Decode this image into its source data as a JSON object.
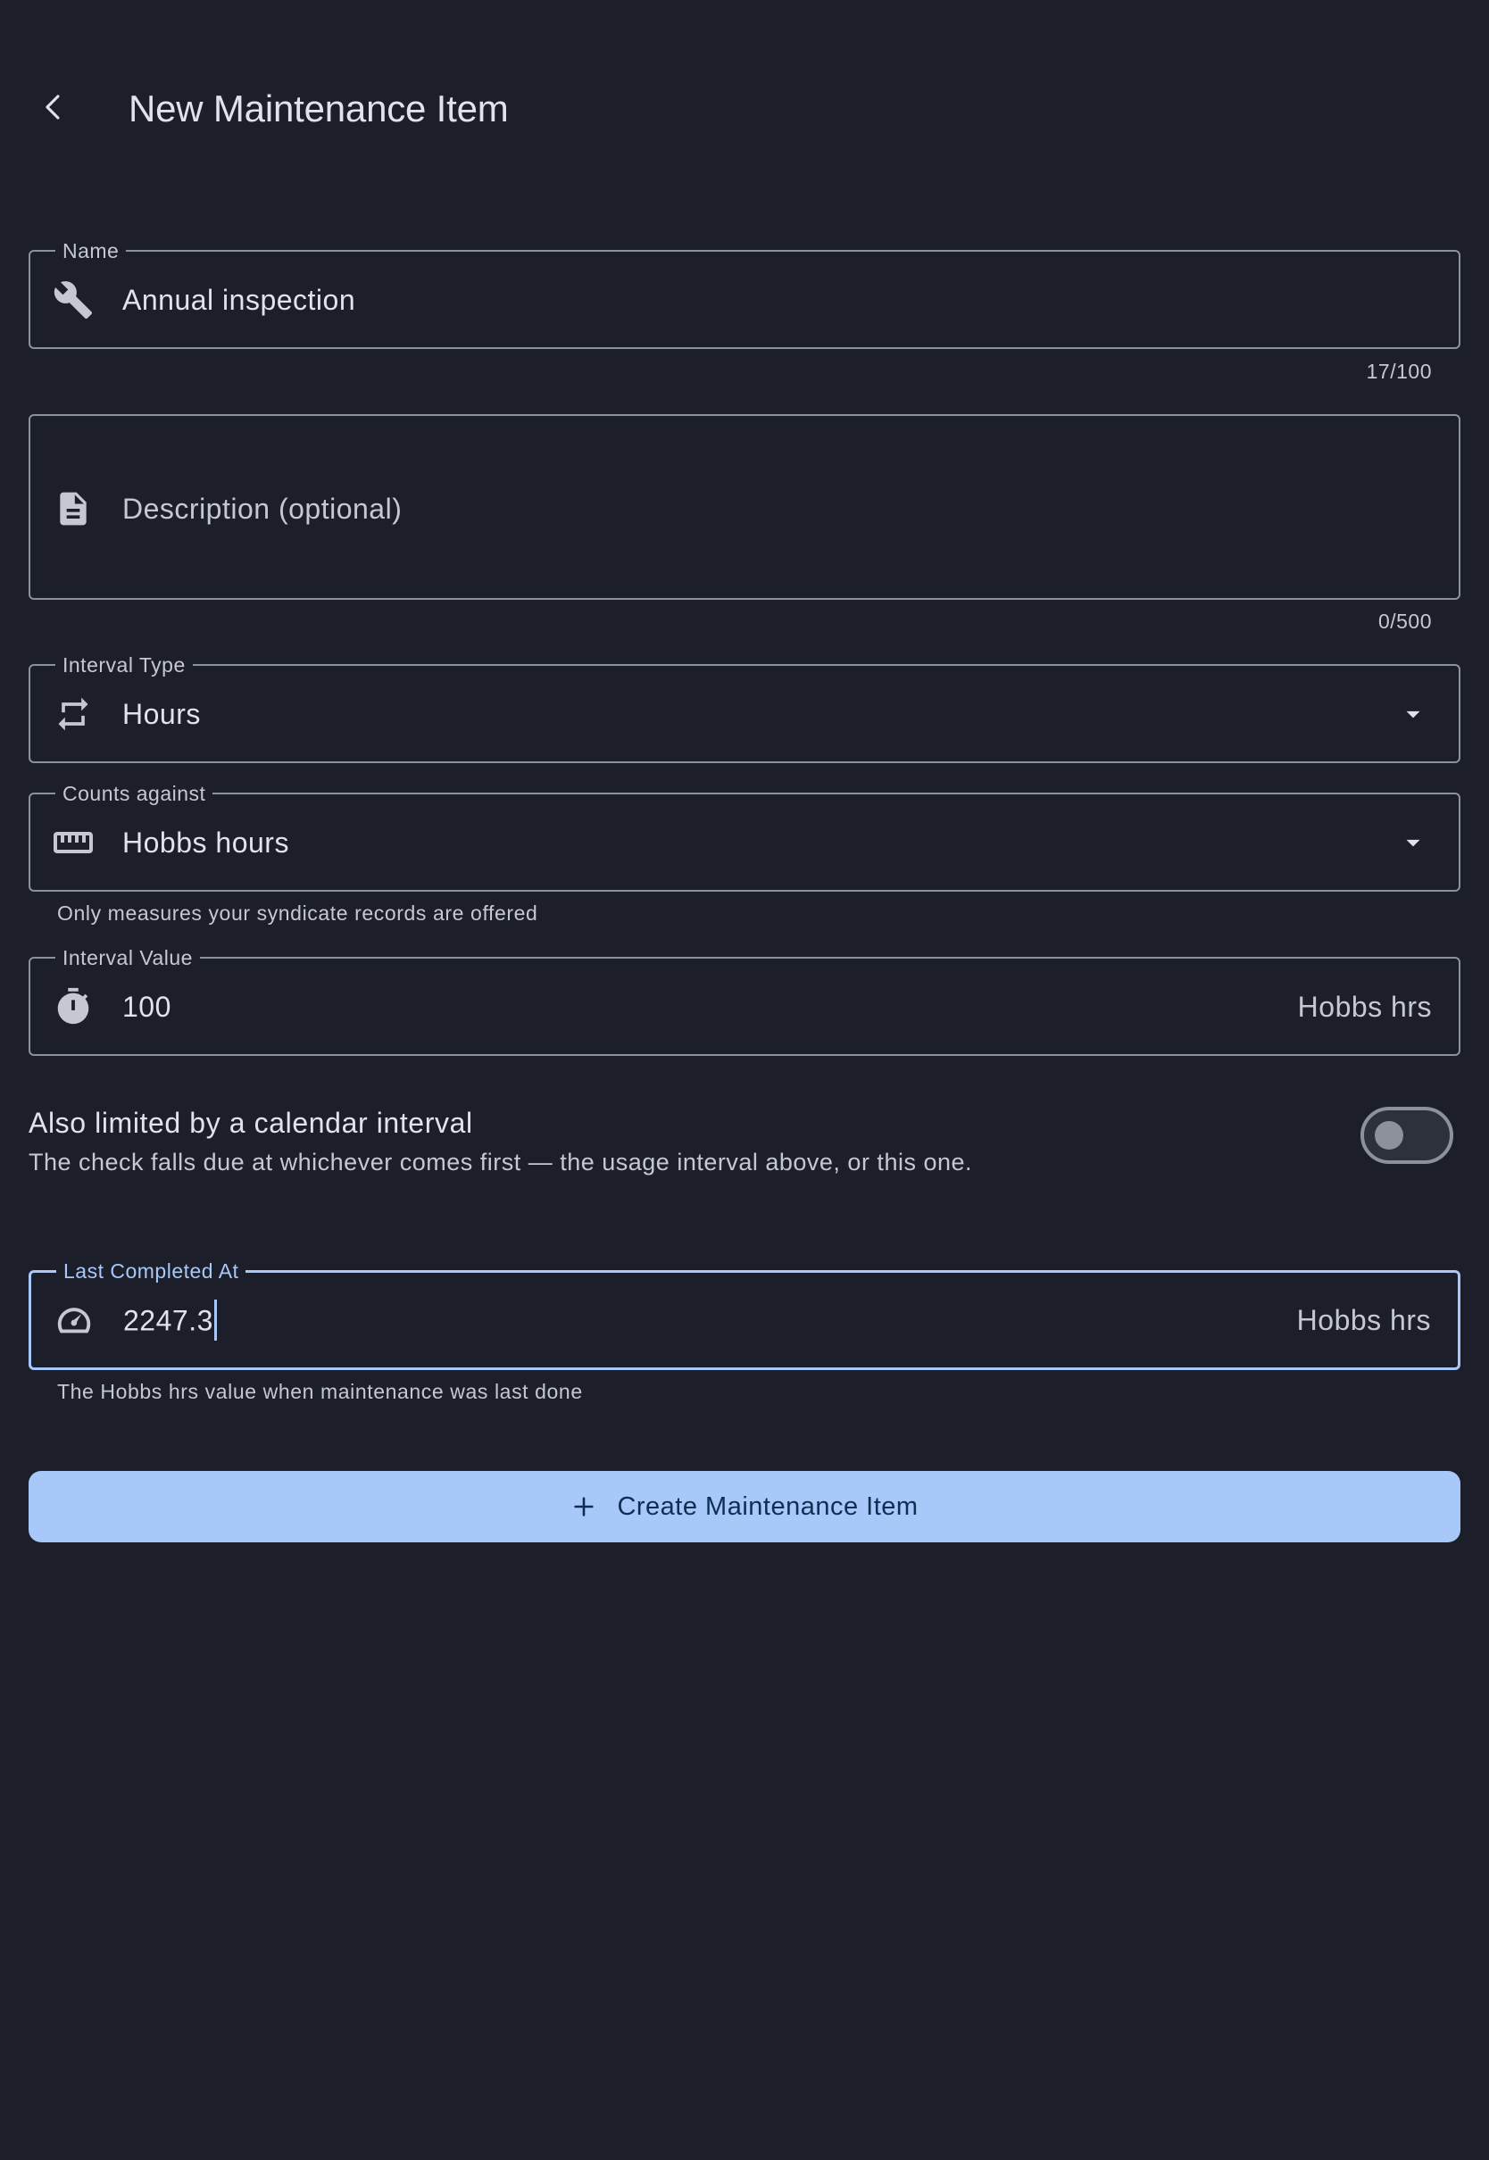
{
  "header": {
    "title": "New Maintenance Item",
    "back_icon": "arrow-back-icon"
  },
  "form": {
    "name": {
      "label": "Name",
      "value": "Annual inspection",
      "icon": "wrench-icon",
      "counter": "17/100"
    },
    "description": {
      "placeholder": "Description (optional)",
      "icon": "document-icon",
      "counter": "0/500"
    },
    "interval_type": {
      "label": "Interval Type",
      "value": "Hours",
      "icon": "repeat-icon"
    },
    "counts_against": {
      "label": "Counts against",
      "value": "Hobbs hours",
      "icon": "ruler-icon",
      "helper": "Only measures your syndicate records are offered"
    },
    "interval_value": {
      "label": "Interval Value",
      "value": "100",
      "suffix": "Hobbs hrs",
      "icon": "timer-icon"
    },
    "calendar_toggle": {
      "title": "Also limited by a calendar interval",
      "subtitle": "The check falls due at whichever comes first — the usage interval above, or this one.",
      "enabled": false
    },
    "last_completed": {
      "label": "Last Completed At",
      "value": "2247.3",
      "suffix": "Hobbs hrs",
      "icon": "speedometer-icon",
      "helper": "The Hobbs hrs value when maintenance was last done",
      "focused": true
    }
  },
  "actions": {
    "create_label": "Create Maintenance Item",
    "create_icon": "plus-icon"
  },
  "colors": {
    "background": "#1c1f29",
    "accent": "#a7c8f8",
    "outline": "#8d919c",
    "text": "#e2e3ea",
    "muted_text": "#c6c8d1",
    "button_text": "#0e2f53"
  }
}
